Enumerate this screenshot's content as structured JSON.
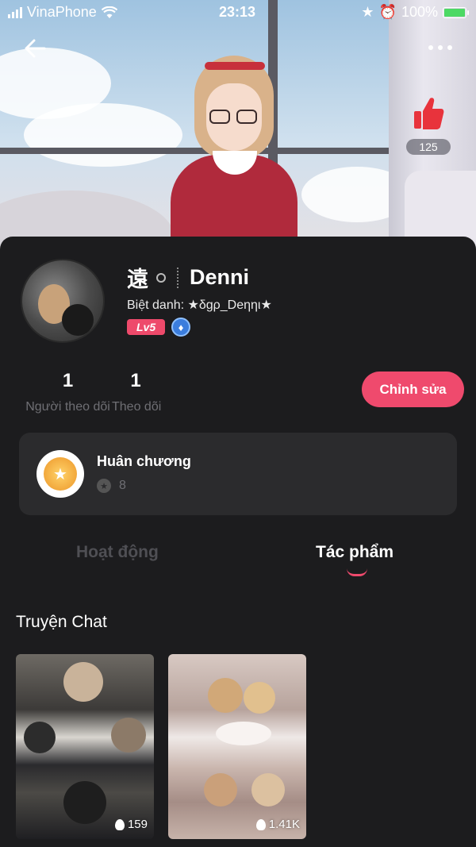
{
  "status_bar": {
    "carrier": "VinaPhone",
    "time": "23:13",
    "battery": "100%"
  },
  "header": {
    "like_count": "125"
  },
  "profile": {
    "name_cjk": "遠",
    "name": "Denni",
    "nickname_label": "Biệt danh:",
    "nickname": "★δgρ_Dеηηι★",
    "level": "Lv5"
  },
  "stats": {
    "followers_count": "1",
    "followers_label": "Người theo dõi",
    "following_count": "1",
    "following_label": "Theo dõi"
  },
  "edit_button_label": "Chỉnh sửa",
  "medals": {
    "title": "Huân chương",
    "count": "8"
  },
  "tabs": [
    {
      "label": "Hoạt động",
      "active": false
    },
    {
      "label": "Tác phẩm",
      "active": true
    }
  ],
  "section": {
    "title": "Truyện Chat"
  },
  "stories": [
    {
      "views": "159"
    },
    {
      "views": "1.41K"
    }
  ],
  "colors": {
    "accent": "#ef4a6d",
    "background": "#1c1c1e",
    "card": "#2b2b2d",
    "verified": "#3b7ddd"
  }
}
